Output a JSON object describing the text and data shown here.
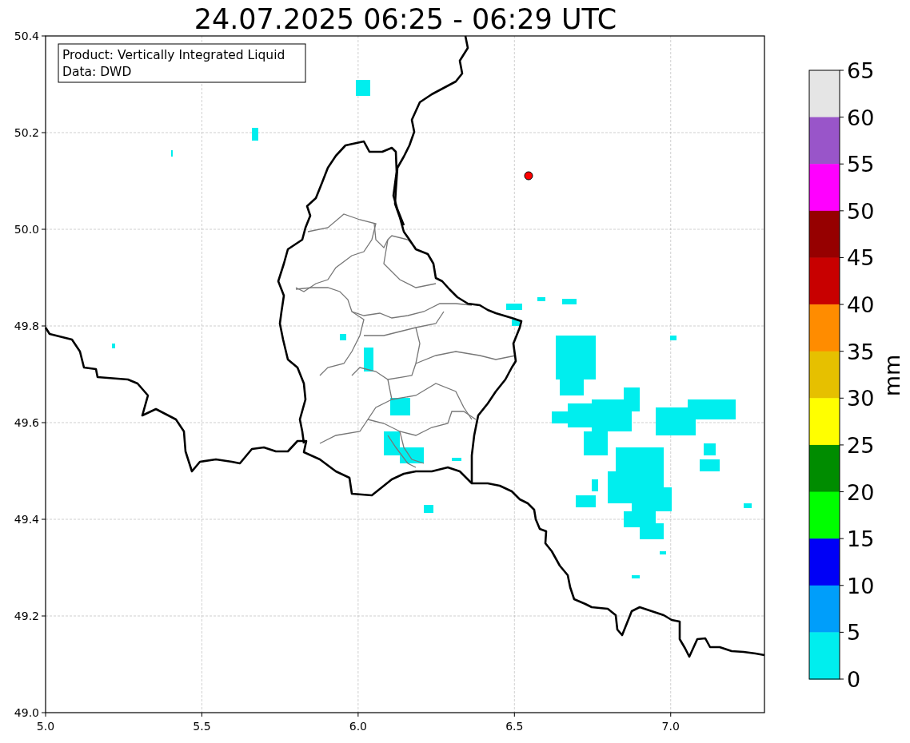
{
  "title": "24.07.2025 06:25 - 06:29 UTC",
  "info_box": [
    "Product: Vertically Integrated Liquid",
    "Data: DWD"
  ],
  "x_ticks": [
    "5.0",
    "5.5",
    "6.0",
    "6.5",
    "7.0"
  ],
  "y_ticks": [
    "50.4",
    "50.2",
    "50.0",
    "49.8",
    "49.6",
    "49.4",
    "49.2",
    "49.0"
  ],
  "colorbar": {
    "label": "mm",
    "ticks": [
      "65",
      "60",
      "55",
      "50",
      "45",
      "40",
      "35",
      "30",
      "25",
      "20",
      "15",
      "10",
      "5",
      "0"
    ],
    "bins": [
      {
        "color": "#e5e5e5"
      },
      {
        "color": "#9955c9"
      },
      {
        "color": "#ff00ff"
      },
      {
        "color": "#960000"
      },
      {
        "color": "#c80000"
      },
      {
        "color": "#ff8c00"
      },
      {
        "color": "#e6c000"
      },
      {
        "color": "#ffff00"
      },
      {
        "color": "#008c00"
      },
      {
        "color": "#00ff00"
      },
      {
        "color": "#0000f6"
      },
      {
        "color": "#009efa"
      },
      {
        "color": "#00eeee"
      }
    ]
  }
}
